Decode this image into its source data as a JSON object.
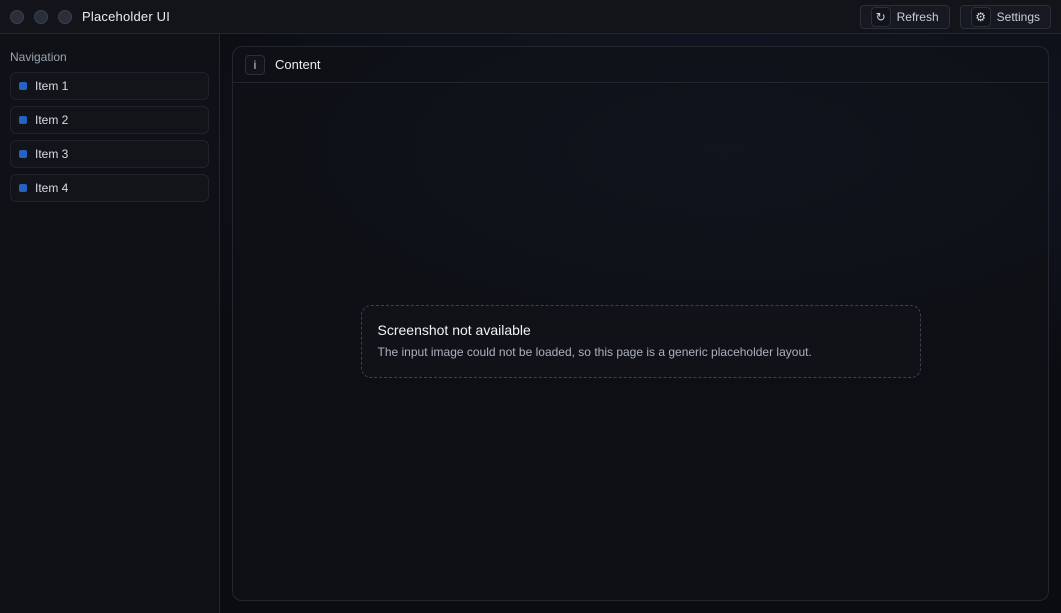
{
  "window": {
    "title": "Placeholder UI"
  },
  "toolbar": {
    "refresh_label": "Refresh",
    "settings_label": "Settings"
  },
  "sidebar": {
    "section_title": "Navigation",
    "items": [
      {
        "label": "Item 1"
      },
      {
        "label": "Item 2"
      },
      {
        "label": "Item 3"
      },
      {
        "label": "Item 4"
      }
    ]
  },
  "main": {
    "panel_title": "Content",
    "notice_title": "Screenshot not available",
    "notice_text": "The input image could not be loaded, so this page is a generic placeholder layout."
  },
  "icons": {
    "refresh": "refresh-icon",
    "settings": "gear-icon",
    "info": "info-icon"
  },
  "colors": {
    "accent": "#2b7cff"
  }
}
